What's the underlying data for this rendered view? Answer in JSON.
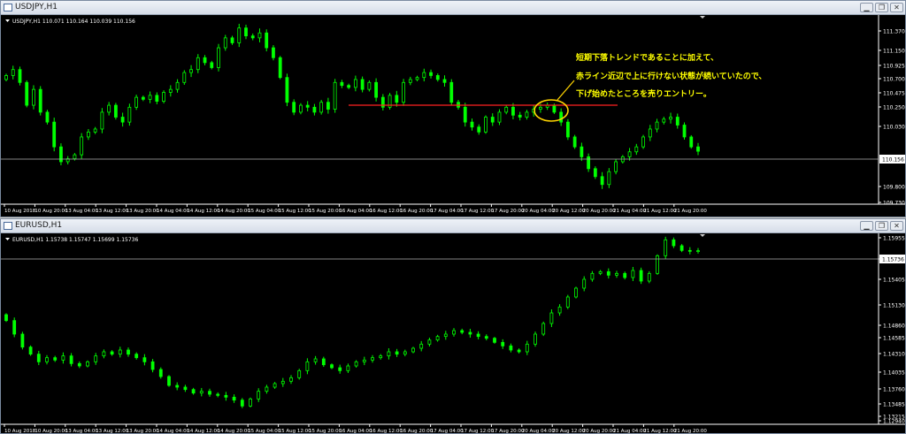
{
  "colors": {
    "candle": "#00ff00",
    "axis": "#ffffff",
    "redline": "#ff2020",
    "annotation": "#ffff00",
    "ellipse": "#ffd400"
  },
  "usdjpy": {
    "title": "USDJPY,H1",
    "info": "USDJPY,H1  110.071 110.164 110.039 110.156",
    "price_labels": [
      "111.370",
      "111.150",
      "110.925",
      "110.700",
      "110.475",
      "110.250",
      "110.030",
      "109.800",
      "109.730"
    ],
    "current_price": "110.156",
    "time_labels": [
      "10 Aug 2018",
      "10 Aug 20:00",
      "13 Aug 04:00",
      "13 Aug 12:00",
      "13 Aug 20:00",
      "14 Aug 04:00",
      "14 Aug 12:00",
      "14 Aug 20:00",
      "15 Aug 04:00",
      "15 Aug 12:00",
      "15 Aug 20:00",
      "16 Aug 04:00",
      "16 Aug 12:00",
      "16 Aug 20:00",
      "17 Aug 04:00",
      "17 Aug 12:00",
      "17 Aug 20:00",
      "20 Aug 04:00",
      "20 Aug 12:00",
      "20 Aug 20:00",
      "21 Aug 04:00",
      "21 Aug 12:00",
      "21 Aug 20:00"
    ],
    "annotation": [
      "短期下落トレンドであることに加えて、",
      "赤ライン近辺で上に行けない状態が続いていたので、",
      "下げ始めたところを売りエントリー。"
    ],
    "closes": [
      110.92,
      110.98,
      110.85,
      110.62,
      110.78,
      110.55,
      110.45,
      110.2,
      110.05,
      110.08,
      110.12,
      110.3,
      110.35,
      110.38,
      110.55,
      110.62,
      110.5,
      110.45,
      110.6,
      110.7,
      110.68,
      110.72,
      110.66,
      110.75,
      110.78,
      110.85,
      110.95,
      110.98,
      111.1,
      111.05,
      111.0,
      111.2,
      111.3,
      111.25,
      111.4,
      111.32,
      111.3,
      111.35,
      111.2,
      111.1,
      110.9,
      110.65,
      110.55,
      110.62,
      110.6,
      110.55,
      110.65,
      110.58,
      110.85,
      110.82,
      110.8,
      110.88,
      110.78,
      110.85,
      110.7,
      110.6,
      110.72,
      110.65,
      110.85,
      110.88,
      110.9,
      110.95,
      110.92,
      110.88,
      110.85,
      110.65,
      110.6,
      110.45,
      110.4,
      110.35,
      110.5,
      110.45,
      110.55,
      110.6,
      110.52,
      110.5,
      110.55,
      110.58,
      110.6,
      110.62,
      110.55,
      110.45,
      110.3,
      110.2,
      110.1,
      109.98,
      109.9,
      109.82,
      109.95,
      110.05,
      110.1,
      110.15,
      110.2,
      110.3,
      110.38,
      110.45,
      110.48,
      110.5,
      110.42,
      110.3,
      110.2,
      110.156
    ]
  },
  "eurusd": {
    "title": "EURUSD,H1",
    "info": "EURUSD,H1  1.15738 1.15747 1.15699 1.15736",
    "price_labels": [
      "1.15955",
      "1.15736",
      "1.15405",
      "1.15130",
      "1.14860",
      "1.14585",
      "1.14310",
      "1.14035",
      "1.13760",
      "1.13485",
      "1.13215",
      "1.12940"
    ],
    "current_price": "1.15736",
    "time_labels": [
      "10 Aug 2018",
      "10 Aug 20:00",
      "13 Aug 04:00",
      "13 Aug 12:00",
      "13 Aug 20:00",
      "14 Aug 04:00",
      "14 Aug 12:00",
      "14 Aug 20:00",
      "15 Aug 04:00",
      "15 Aug 12:00",
      "15 Aug 20:00",
      "16 Aug 04:00",
      "16 Aug 12:00",
      "16 Aug 20:00",
      "17 Aug 04:00",
      "17 Aug 12:00",
      "17 Aug 20:00",
      "20 Aug 04:00",
      "20 Aug 12:00",
      "20 Aug 20:00",
      "21 Aug 04:00",
      "21 Aug 12:00",
      "21 Aug 20:00"
    ],
    "closes": [
      1.1455,
      1.1432,
      1.141,
      1.1398,
      1.1385,
      1.1392,
      1.1388,
      1.1395,
      1.1382,
      1.1378,
      1.1385,
      1.1395,
      1.1402,
      1.1398,
      1.1405,
      1.1398,
      1.1392,
      1.1385,
      1.1372,
      1.136,
      1.1345,
      1.1342,
      1.1338,
      1.1332,
      1.1335,
      1.133,
      1.1328,
      1.1325,
      1.132,
      1.131,
      1.1322,
      1.1335,
      1.1342,
      1.1348,
      1.1352,
      1.1358,
      1.137,
      1.1385,
      1.139,
      1.138,
      1.1375,
      1.137,
      1.1378,
      1.1385,
      1.1388,
      1.1392,
      1.1395,
      1.1402,
      1.1398,
      1.1402,
      1.1408,
      1.1415,
      1.1422,
      1.1428,
      1.1432,
      1.1438,
      1.1435,
      1.1432,
      1.1428,
      1.1425,
      1.1418,
      1.1412,
      1.1405,
      1.1402,
      1.1415,
      1.1432,
      1.145,
      1.1468,
      1.1478,
      1.1495,
      1.151,
      1.1525,
      1.1535,
      1.1538,
      1.1532,
      1.1535,
      1.1528,
      1.154,
      1.1522,
      1.1535,
      1.1565,
      1.1592,
      1.1582,
      1.1574,
      1.1573,
      1.15736
    ]
  }
}
